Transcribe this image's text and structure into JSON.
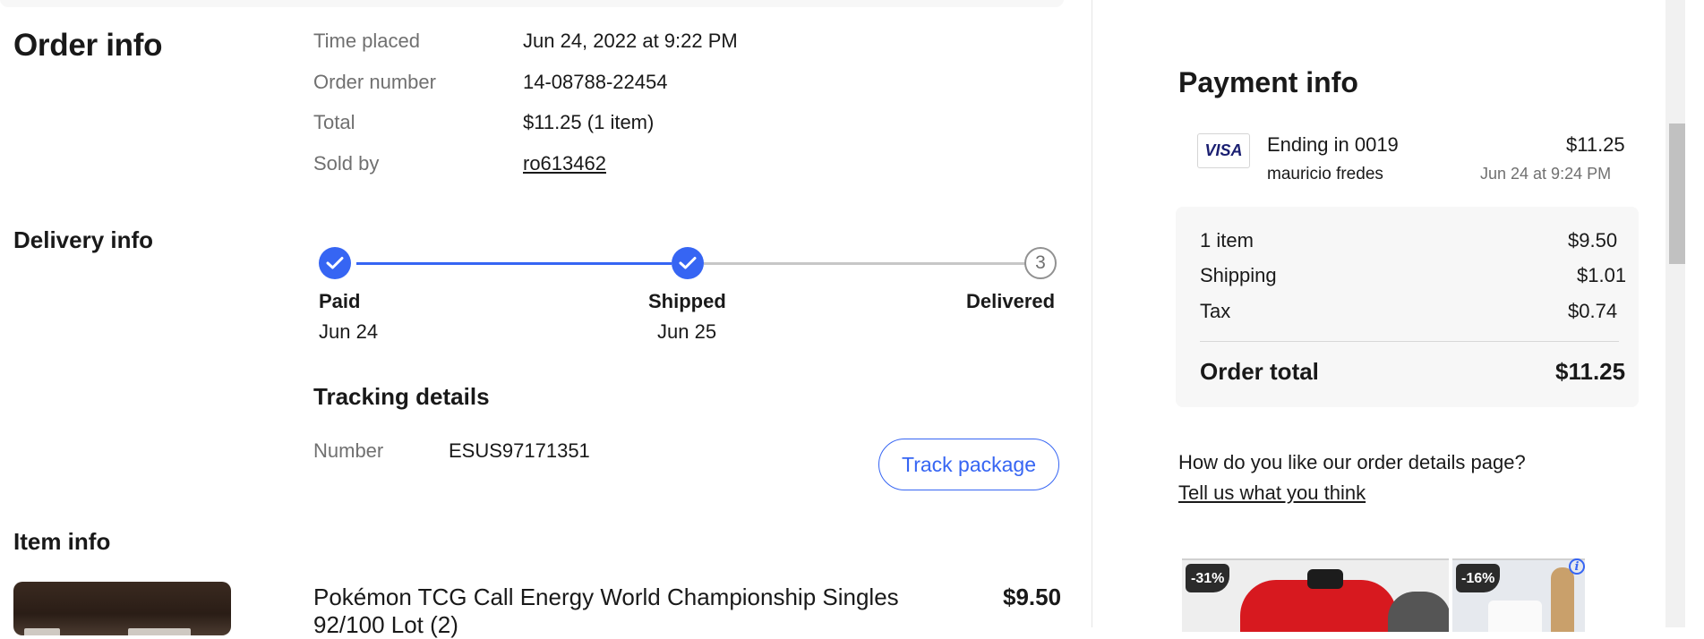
{
  "order_info": {
    "heading": "Order info",
    "rows": [
      {
        "label": "Time placed",
        "value": "Jun 24, 2022 at 9:22 PM"
      },
      {
        "label": "Order number",
        "value": "14-08788-22454"
      },
      {
        "label": "Total",
        "value": "$11.25 (1 item)"
      },
      {
        "label": "Sold by",
        "value": "ro613462"
      }
    ]
  },
  "delivery_info": {
    "heading": "Delivery info",
    "progress_completed_steps": 2,
    "steps": [
      {
        "name": "Paid",
        "date": "Jun 24",
        "status": "done"
      },
      {
        "name": "Shipped",
        "date": "Jun 25",
        "status": "done"
      },
      {
        "name": "Delivered",
        "date": "",
        "status": "pending",
        "number": "3"
      }
    ],
    "tracking": {
      "heading": "Tracking details",
      "number_label": "Number",
      "number_value": "ESUS97171351",
      "button_label": "Track package"
    }
  },
  "item_info": {
    "heading": "Item info",
    "items": [
      {
        "title_line1": "Pokémon TCG Call Energy World Championship Singles",
        "title_line2": "92/100 Lot (2)",
        "price": "$9.50"
      }
    ]
  },
  "payment_info": {
    "heading": "Payment info",
    "card_brand": "VISA",
    "card_ending": "Ending in 0019",
    "card_holder": "mauricio fredes",
    "amount": "$11.25",
    "date": "Jun 24 at 9:24 PM",
    "summary": [
      {
        "label": "1 item",
        "value": "$9.50"
      },
      {
        "label": "Shipping",
        "value": "$1.01"
      },
      {
        "label": "Tax",
        "value": "$0.74"
      }
    ],
    "total_label": "Order total",
    "total_value": "$11.25"
  },
  "feedback": {
    "question": "How do you like our order details page?",
    "link": "Tell us what you think"
  },
  "ads": [
    {
      "badge": "-31%"
    },
    {
      "badge": "-16%"
    }
  ],
  "colors": {
    "accent": "#3665f3",
    "text": "#191919",
    "muted": "#707070"
  }
}
